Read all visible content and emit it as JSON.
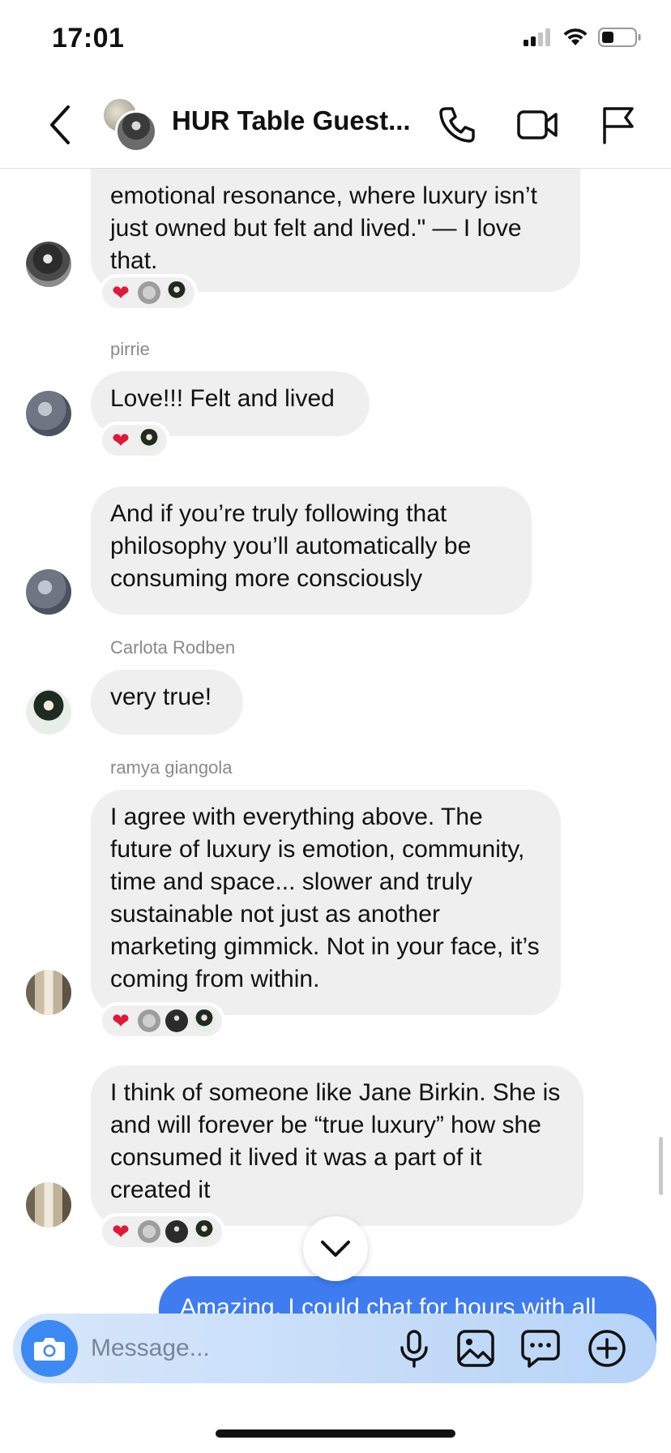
{
  "status": {
    "time": "17:01"
  },
  "header": {
    "title": "HUR Table Guest...",
    "icons": [
      "back-icon",
      "phone-icon",
      "video-icon",
      "flag-icon"
    ]
  },
  "messages": [
    {
      "text": "emotional resonance, where luxury isn’t just owned but felt and lived.\" — I love that.",
      "reactions": [
        "heart",
        "avatar",
        "avatar"
      ]
    },
    {
      "sender": "pirrie",
      "text": "Love!!! Felt and lived",
      "reactions": [
        "heart",
        "avatar"
      ]
    },
    {
      "text": "And if you’re truly following that philosophy you’ll automatically be consuming more consciously"
    },
    {
      "sender": "Carlota Rodben",
      "text": "very true!"
    },
    {
      "sender": "ramya giangola",
      "text": "I agree with everything above. The future of luxury is emotion, community, time and space... slower and truly sustainable not just as another marketing gimmick. Not in your face, it’s coming from within.",
      "reactions": [
        "heart",
        "avatar",
        "avatar",
        "avatar"
      ]
    },
    {
      "text": "I think of someone like Jane Birkin. She is and will forever be “true luxury” how she consumed it lived it was a part of it created it",
      "reactions": [
        "heart",
        "avatar",
        "avatar",
        "avatar"
      ]
    }
  ],
  "outgoing": {
    "text": "Amazing. I could chat for hours with all"
  },
  "composer": {
    "placeholder": "Message..."
  },
  "colors": {
    "accent": "#3c89f3",
    "outgoing_bubble": "#3e7cf0",
    "incoming_bubble": "#efefef",
    "heart": "#e0183a"
  }
}
